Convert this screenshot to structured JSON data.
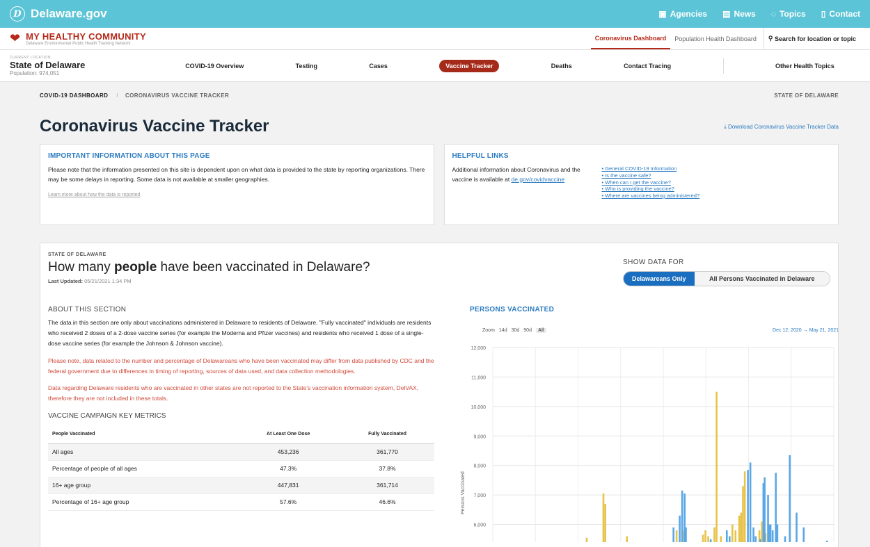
{
  "topbar": {
    "brand": "Delaware.gov",
    "logo_letter": "D",
    "links": [
      {
        "icon": "building-icon",
        "label": "Agencies"
      },
      {
        "icon": "newspaper-icon",
        "label": "News"
      },
      {
        "icon": "chat-icon",
        "label": "Topics"
      },
      {
        "icon": "phone-icon",
        "label": "Contact"
      }
    ]
  },
  "app": {
    "title": "MY HEALTHY COMMUNITY",
    "subtitle": "Delaware Environmental Public Health Tracking Network",
    "tabs": [
      "Coronavirus Dashboard",
      "Population Health Dashboard"
    ],
    "search": "Search for location or topic"
  },
  "location": {
    "label": "CURRENT LOCATION",
    "name": "State of Delaware",
    "population": "Population: 974,051"
  },
  "nav": [
    "COVID-19 Overview",
    "Testing",
    "Cases",
    "Vaccine Tracker",
    "Deaths",
    "Contact Tracing",
    "Other Health Topics"
  ],
  "breadcrumb": {
    "root": "COVID-19 DASHBOARD",
    "current": "CORONAVIRUS VACCINE TRACKER",
    "state": "STATE OF DELAWARE"
  },
  "page_title": "Coronavirus Vaccine Tracker",
  "download": "Download Coronavirus Vaccine Tracker Data",
  "info": {
    "title": "IMPORTANT INFORMATION ABOUT THIS PAGE",
    "text": "Please note that the information presented on this site is dependent upon on what data is provided to the state by reporting organizations. There may be some delays in reporting. Some data is not available at smaller geographies.",
    "learn": "Learn more about how the data is reported"
  },
  "links": {
    "title": "HELPFUL LINKS",
    "text": "Additional information about Coronavirus and the vaccine is available at ",
    "url": "de.gov/covidvaccine",
    "items": [
      "General COVID-19 Information",
      "Is the vaccine safe?",
      "When can I get the vaccine?",
      "Who is providing the vaccine?",
      "Where are vaccines being administered?"
    ]
  },
  "section": {
    "label": "STATE OF DELAWARE",
    "heading_pre": "How many ",
    "heading_bold": "people",
    "heading_post": " have been vaccinated in Delaware?",
    "updated_label": "Last Updated:",
    "updated": "05/21/2021 1:34 PM",
    "show_label": "SHOW DATA FOR",
    "toggle": [
      "Delawareans Only",
      "All Persons Vaccinated in Delaware"
    ]
  },
  "about": {
    "title": "ABOUT THIS SECTION",
    "p1": "The data in this section are only about vaccinations administered in Delaware to residents of Delaware. \"Fully vaccinated\" individuals are residents who received 2 doses of a 2-dose vaccine series (for example the Moderna and Pfizer vaccines) and residents who received 1 dose of a single-dose vaccine series (for example the Johnson & Johnson vaccine).",
    "p2": "Please note, data related to the number and percentage of Delawareans who have been vaccinated may differ from data published by CDC and the federal government due to differences in timing of reporting, sources of data used, and data collection methodologies.",
    "p3": "Data regarding Delaware residents who are vaccinated in other states are not reported to the State's vaccination information system, DelVAX, therefore they are not included in these totals."
  },
  "metrics": {
    "title": "VACCINE CAMPAIGN KEY METRICS",
    "headers": [
      "People Vaccinated",
      "At Least One Dose",
      "Fully Vaccinated"
    ],
    "rows": [
      [
        "All ages",
        "453,236",
        "361,770"
      ],
      [
        "Percentage of people of all ages",
        "47.3%",
        "37.8%"
      ],
      [
        "16+ age group",
        "447,831",
        "361,714"
      ],
      [
        "Percentage of 16+ age group",
        "57.6%",
        "46.6%"
      ]
    ]
  },
  "chart": {
    "title": "PERSONS VACCINATED",
    "zoom_label": "Zoom",
    "zoom": [
      "14d",
      "30d",
      "90d",
      "All"
    ],
    "range_start": "Dec 12, 2020",
    "range_arrow": "→",
    "range_end": "May 21, 2021",
    "ylabel": "Persons Vaccinated"
  },
  "colors": {
    "yellow": "#e8c34a",
    "blue": "#5aa7e6"
  },
  "chart_data": {
    "type": "bar",
    "ylabel": "Persons Vaccinated",
    "yticks": [
      12000,
      11000,
      10000,
      9000,
      8000,
      7000,
      6000
    ],
    "ylim": [
      5400,
      12000
    ],
    "series": [
      {
        "color": "yellow",
        "values": [
          [
            0.3,
            5550
          ],
          [
            0.354,
            7050
          ],
          [
            0.36,
            6700
          ],
          [
            0.43,
            5600
          ],
          [
            0.59,
            5800
          ],
          [
            0.601,
            5200
          ],
          [
            0.61,
            5800
          ],
          [
            0.675,
            5650
          ],
          [
            0.683,
            5800
          ],
          [
            0.692,
            5600
          ],
          [
            0.712,
            5900
          ],
          [
            0.719,
            10500
          ],
          [
            0.733,
            5600
          ],
          [
            0.77,
            6000
          ],
          [
            0.78,
            5800
          ],
          [
            0.792,
            6300
          ],
          [
            0.798,
            6400
          ],
          [
            0.804,
            7300
          ],
          [
            0.81,
            7800
          ],
          [
            0.832,
            5300
          ],
          [
            0.84,
            5400
          ],
          [
            0.857,
            5800
          ],
          [
            0.865,
            6100
          ],
          [
            0.877,
            5700
          ]
        ]
      },
      {
        "color": "blue",
        "values": [
          [
            0.58,
            5900
          ],
          [
            0.6,
            6300
          ],
          [
            0.608,
            7150
          ],
          [
            0.616,
            7050
          ],
          [
            0.62,
            5900
          ],
          [
            0.7,
            5500
          ],
          [
            0.752,
            5800
          ],
          [
            0.761,
            5600
          ],
          [
            0.772,
            5300
          ],
          [
            0.82,
            7850
          ],
          [
            0.828,
            8100
          ],
          [
            0.838,
            5900
          ],
          [
            0.845,
            5600
          ],
          [
            0.86,
            5500
          ],
          [
            0.87,
            7400
          ],
          [
            0.874,
            7600
          ],
          [
            0.885,
            7000
          ],
          [
            0.889,
            6000
          ],
          [
            0.893,
            6000
          ],
          [
            0.9,
            5800
          ],
          [
            0.91,
            7750
          ],
          [
            0.915,
            6000
          ],
          [
            0.93,
            5300
          ],
          [
            0.94,
            5600
          ],
          [
            0.955,
            8350
          ],
          [
            0.977,
            6400
          ],
          [
            1.0,
            5900
          ],
          [
            1.075,
            5450
          ]
        ]
      }
    ]
  }
}
